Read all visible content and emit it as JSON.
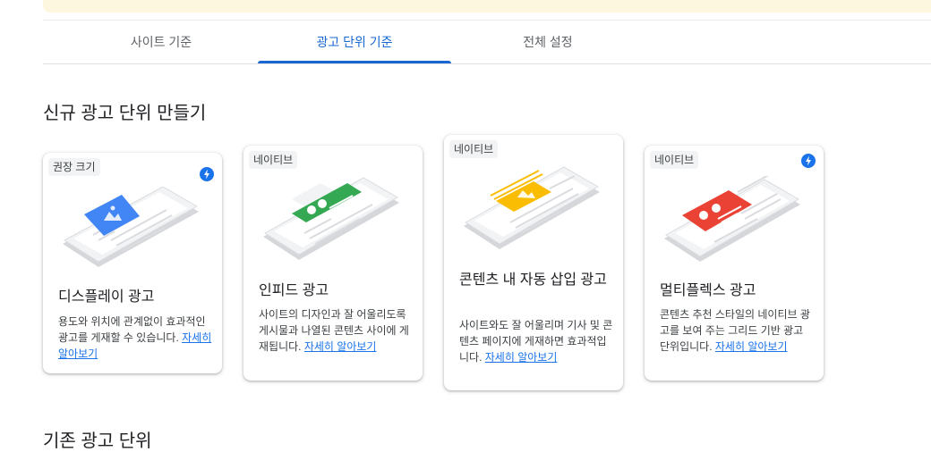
{
  "tabs": [
    {
      "label": "사이트 기준"
    },
    {
      "label": "광고 단위 기준"
    },
    {
      "label": "전체 설정"
    }
  ],
  "sections": {
    "create_title": "신규 광고 단위 만들기",
    "existing_title": "기존 광고 단위"
  },
  "colors": {
    "accent": "#1a73e8",
    "display": "#4285f4",
    "infeed": "#34a853",
    "inarticle": "#fbbc04",
    "multiplex": "#ea4335"
  },
  "cards": [
    {
      "badge": "권장 크기",
      "has_bolt": true,
      "bolt_icon": "lightning-bolt-icon",
      "title": "디스플레이 광고",
      "description": "용도와 위치에 관계없이 효과적인 광고를 게재할 수 있습니다.",
      "learn_more": "자세히 알아보기"
    },
    {
      "badge": "네이티브",
      "has_bolt": false,
      "title": "인피드 광고",
      "description": "사이트의 디자인과 잘 어울리도록 게시물과 나열된 콘텐츠 사이에 게재됩니다.",
      "learn_more": "자세히 알아보기"
    },
    {
      "badge": "네이티브",
      "has_bolt": false,
      "title": "콘텐츠 내 자동 삽입 광고",
      "description": "사이트와도 잘 어울리며 기사 및 콘텐츠 페이지에 게재하면 효과적입니다.",
      "learn_more": "자세히 알아보기"
    },
    {
      "badge": "네이티브",
      "has_bolt": true,
      "bolt_icon": "lightning-bolt-icon",
      "title": "멀티플렉스 광고",
      "description": "콘텐츠 추천 스타일의 네이티브 광고를 보여 주는 그리드 기반 광고 단위입니다.",
      "learn_more": "자세히 알아보기"
    }
  ]
}
